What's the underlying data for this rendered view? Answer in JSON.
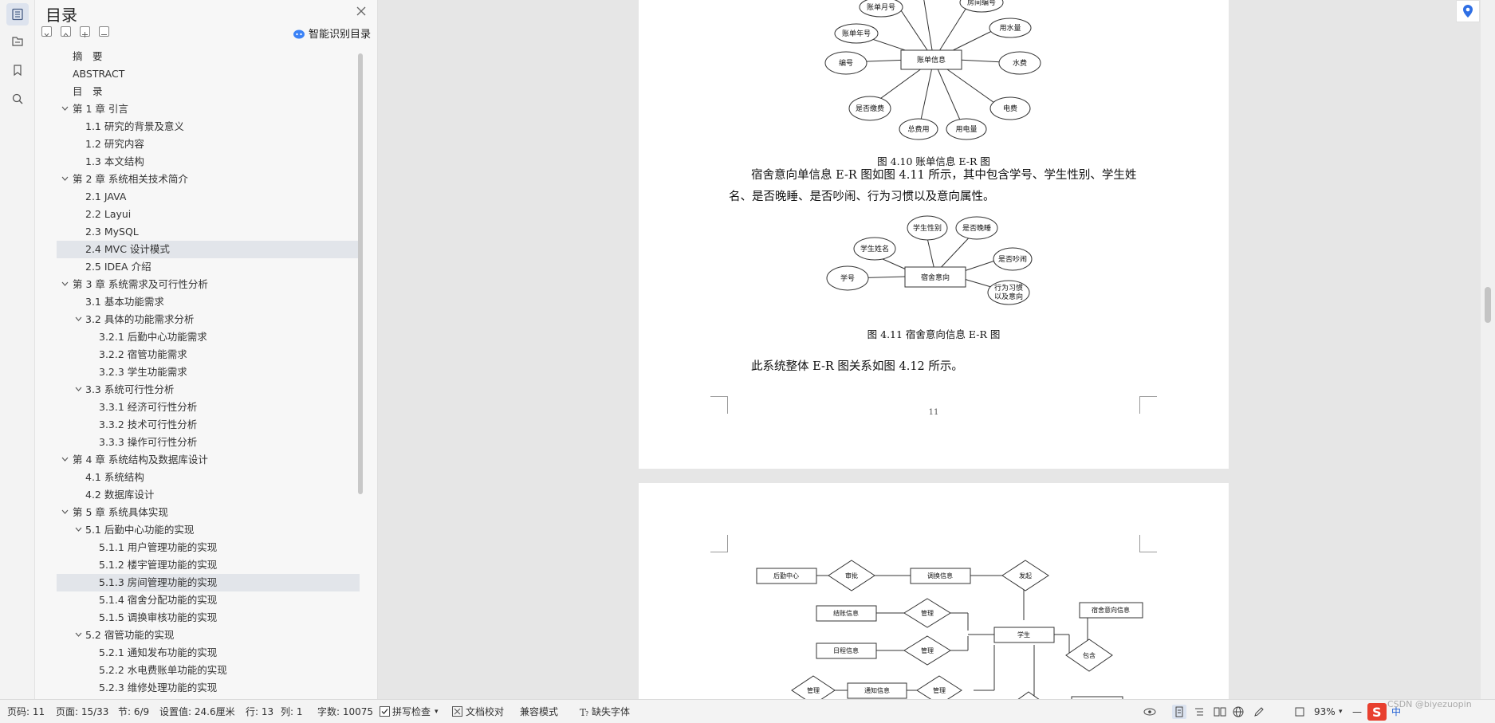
{
  "toc": {
    "title": "目录",
    "ai_label": "智能识别目录",
    "items": [
      {
        "label": "摘　要",
        "level": 1
      },
      {
        "label": "ABSTRACT",
        "level": 1
      },
      {
        "label": "目　录",
        "level": 1
      },
      {
        "label": "第 1 章  引言",
        "level": 1
      },
      {
        "label": "1.1  研究的背景及意义",
        "level": 2
      },
      {
        "label": "1.2  研究内容",
        "level": 2
      },
      {
        "label": "1.3  本文结构",
        "level": 2
      },
      {
        "label": "第 2 章  系统相关技术简介",
        "level": 1
      },
      {
        "label": "2.1 JAVA",
        "level": 2
      },
      {
        "label": "2.2 Layui",
        "level": 2
      },
      {
        "label": "2.3 MySQL",
        "level": 2
      },
      {
        "label": "2.4 MVC 设计模式",
        "level": 2
      },
      {
        "label": "2.5 IDEA 介绍",
        "level": 2
      },
      {
        "label": "第 3 章  系统需求及可行性分析",
        "level": 1
      },
      {
        "label": "3.1 基本功能需求",
        "level": 2
      },
      {
        "label": "3.2  具体的功能需求分析",
        "level": 2
      },
      {
        "label": "3.2.1  后勤中心功能需求",
        "level": 3
      },
      {
        "label": "3.2.2  宿管功能需求",
        "level": 3
      },
      {
        "label": "3.2.3  学生功能需求",
        "level": 3
      },
      {
        "label": "3.3  系统可行性分析",
        "level": 2
      },
      {
        "label": "3.3.1  经济可行性分析",
        "level": 3
      },
      {
        "label": "3.3.2  技术可行性分析",
        "level": 3
      },
      {
        "label": "3.3.3  操作可行性分析",
        "level": 3
      },
      {
        "label": "第 4 章  系统结构及数据库设计",
        "level": 1
      },
      {
        "label": "4.1  系统结构",
        "level": 2
      },
      {
        "label": "4.2  数据库设计",
        "level": 2
      },
      {
        "label": "第 5 章  系统具体实现",
        "level": 1
      },
      {
        "label": "5.1  后勤中心功能的实现",
        "level": 2
      },
      {
        "label": "5.1.1  用户管理功能的实现",
        "level": 3
      },
      {
        "label": "5.1.2  楼宇管理功能的实现",
        "level": 3
      },
      {
        "label": "5.1.3  房间管理功能的实现",
        "level": 3
      },
      {
        "label": "5.1.4  宿舍分配功能的实现",
        "level": 3
      },
      {
        "label": "5.1.5  调换审核功能的实现",
        "level": 3
      },
      {
        "label": "5.2  宿管功能的实现",
        "level": 2
      },
      {
        "label": "5.2.1  通知发布功能的实现",
        "level": 3
      },
      {
        "label": "5.2.2  水电费账单功能的实现",
        "level": 3
      },
      {
        "label": "5.2.3  维修处理功能的实现",
        "level": 3
      }
    ]
  },
  "document": {
    "fig410_nodes": [
      "账单月号",
      "房间编号",
      "账单年号",
      "用水量",
      "编号",
      "水费",
      "是否缴费",
      "总费用",
      "用电量",
      "电费"
    ],
    "fig410_entity": "账单信息",
    "fig410_caption": "图 4.10  账单信息 E-R 图",
    "para1_line1": "宿舍意向单信息 E-R 图如图 4.11 所示，其中包含学号、学生性别、学生姓",
    "para1_line2": "名、是否晚睡、是否吵闹、行为习惯以及意向属性。",
    "fig411_nodes": [
      "学生性别",
      "是否晚睡",
      "学生姓名",
      "是否吵闹",
      "学号",
      "行为习惯",
      "以及意向"
    ],
    "fig411_entity": "宿舍意向",
    "fig411_caption": "图 4.11  宿舍意向信息 E-R 图",
    "para2": "此系统整体 E-R 图关系如图 4.12 所示。",
    "page_number": "11",
    "fig412_labels": [
      "后勤中心",
      "审批",
      "调换信息",
      "发起",
      "宿舍意向信息",
      "结账信息",
      "管理",
      "学生",
      "日程信息",
      "管理",
      "包含",
      "管理",
      "通知信息",
      "管理"
    ]
  },
  "status": {
    "page_code": "页码: 11",
    "page": "页面: 15/33",
    "section": "节: 6/9",
    "setting": "设置值: 24.6厘米",
    "row": "行: 13",
    "col": "列: 1",
    "words": "字数: 10075",
    "spell": "拼写检查",
    "proof": "文档校对",
    "compat": "兼容模式",
    "missing_font": "缺失字体",
    "zoom": "93%",
    "ime": "中",
    "watermark": "CSDN @biyezuopin"
  }
}
